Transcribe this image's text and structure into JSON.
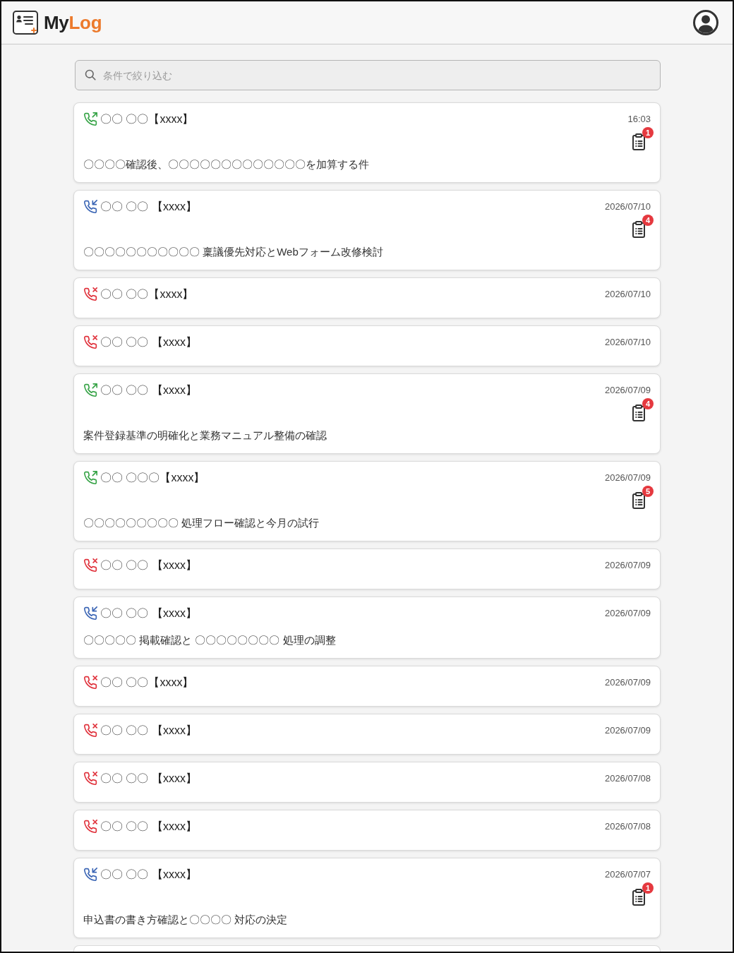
{
  "header": {
    "logo": {
      "text_main": "My",
      "text_accent": "Log"
    }
  },
  "search": {
    "placeholder": "条件で絞り込む"
  },
  "calls": [
    {
      "kind": "outgoing",
      "title": "〇〇 〇〇【xxxx】",
      "time": "16:03",
      "memo": {
        "count": "1"
      },
      "description": "〇〇〇〇確認後、〇〇〇〇〇〇〇〇〇〇〇〇〇を加算する件"
    },
    {
      "kind": "incoming",
      "title": "〇〇 〇〇 【xxxx】",
      "time": "2026/07/10",
      "memo": {
        "count": "4"
      },
      "description": "〇〇〇〇〇〇〇〇〇〇〇 稟議優先対応とWebフォーム改修検討"
    },
    {
      "kind": "missed",
      "title": "〇〇 〇〇【xxxx】",
      "time": "2026/07/10"
    },
    {
      "kind": "missed",
      "title": "〇〇 〇〇 【xxxx】",
      "time": "2026/07/10"
    },
    {
      "kind": "outgoing",
      "title": "〇〇 〇〇 【xxxx】",
      "time": "2026/07/09",
      "memo": {
        "count": "4"
      },
      "description": "案件登録基準の明確化と業務マニュアル整備の確認"
    },
    {
      "kind": "outgoing",
      "title": "〇〇 〇〇〇【xxxx】",
      "time": "2026/07/09",
      "memo": {
        "count": "5"
      },
      "description": "〇〇〇〇〇〇〇〇〇 処理フロー確認と今月の試行"
    },
    {
      "kind": "missed",
      "title": "〇〇 〇〇 【xxxx】",
      "time": "2026/07/09"
    },
    {
      "kind": "incoming",
      "title": "〇〇 〇〇 【xxxx】",
      "time": "2026/07/09",
      "description": "〇〇〇〇〇 掲載確認と 〇〇〇〇〇〇〇〇 処理の調整"
    },
    {
      "kind": "missed",
      "title": "〇〇 〇〇【xxxx】",
      "time": "2026/07/09"
    },
    {
      "kind": "missed",
      "title": "〇〇 〇〇 【xxxx】",
      "time": "2026/07/09"
    },
    {
      "kind": "missed",
      "title": "〇〇 〇〇 【xxxx】",
      "time": "2026/07/08"
    },
    {
      "kind": "missed",
      "title": "〇〇 〇〇 【xxxx】",
      "time": "2026/07/08"
    },
    {
      "kind": "incoming",
      "title": "〇〇 〇〇 【xxxx】",
      "time": "2026/07/07",
      "memo": {
        "count": "1"
      },
      "description": "申込書の書き方確認と〇〇〇〇 対応の決定"
    }
  ]
}
